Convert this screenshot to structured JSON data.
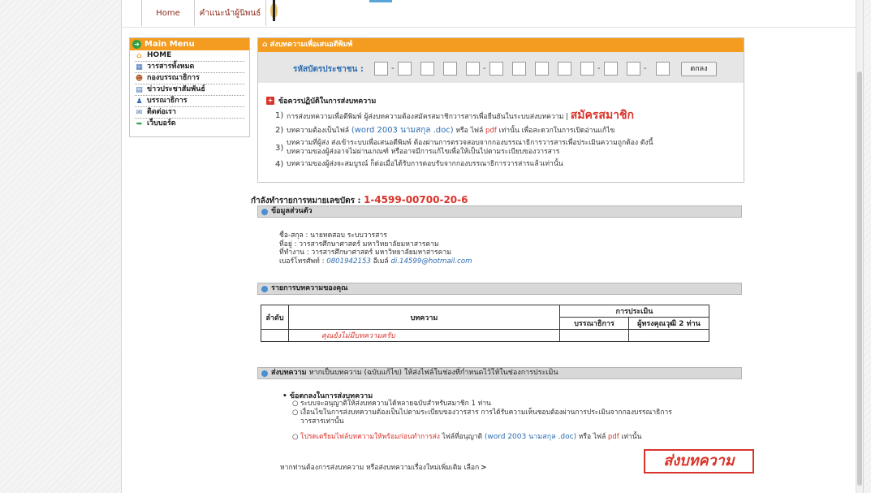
{
  "nav": {
    "home": "Home",
    "guide": "คำแนะนำผู้นิพนธ์"
  },
  "menu": {
    "title": "Main Menu",
    "items": [
      "HOME",
      "วารสารทั้งหมด",
      "กองบรรณาธิการ",
      "ข่าวประชาสัมพันธ์",
      "บรรณาธิการ",
      "ติดต่อเรา",
      "เว็บบอร์ด"
    ]
  },
  "submit_panel": {
    "title": "ส่งบทความเพื่อเสนอตีพิมพ์",
    "id_label": "รหัสบัตรประชาชน :",
    "ok_button": "ตกลง",
    "rules_title": "ข้อควรปฏิบัติในการส่งบทความ",
    "rules": [
      {
        "num": "1)",
        "text": "การส่งบทความเพื่อตีพิมพ์ ผู้ส่งบทความต้องสมัครสมาชิกวารสารเพื่อยืนยันในระบบส่งบทความ |",
        "link": "สมัครสมาชิก"
      },
      {
        "num": "2)",
        "pre": "บทความต้องเป็นไฟล์",
        "word": "(word 2003 นามสกุล .doc)",
        "mid": "หรือ ไฟล์",
        "pdf": "pdf",
        "post": "เท่านั้น เพื่อสะดวกในการเปิดอ่านแก้ไข"
      },
      {
        "num": "3)",
        "line1": "บทความที่ผู้ส่ง ส่งเข้าระบบเพื่อเสนอตีพิมพ์ ต้องผ่านการตรวจสอบจากกองบรรณาธิการวารสารเพื่อประเมินความถูกต้อง ดังนี้",
        "line2": "บทความของผู้ส่งอาจไม่ผ่านเกณฑ์ หรืออาจมีการแก้ไขเพื่อให้เป็นไปตามระเบียบของวารสาร"
      },
      {
        "num": "4)",
        "text": "บทความของผู้ส่งจะสมบูรณ์ ก็ต่อเมื่อได้รับการตอบรับจากกองบรรณาธิการวารสารแล้วเท่านั้น"
      }
    ]
  },
  "doing": {
    "label": "กำลังทำรายการหมายเลขบัตร :",
    "code": "1-4599-00700-20-6"
  },
  "personal": {
    "header": "ข้อมูลส่วนตัว",
    "name": "ชื่อ-สกุล : นายทดสอบ ระบบวารสาร",
    "address": "ที่อยู่ : วารสารศึกษาศาสตร์ มหาวิทยาลัยมหาสารคาม",
    "workplace": "ที่ทำงาน : วารสารศึกษาศาสตร์ มหาวิทยาลัยมหาสารคาม",
    "phone_label": "เบอร์โทรศัพท์ :",
    "phone": "0801942153",
    "email_label": "อีเมล์",
    "email": "di.14599@hotmail.com"
  },
  "articles": {
    "header": "รายการบทความของคุณ",
    "col_no": "ลำดับ",
    "col_article": "บทความ",
    "col_eval": "การประเมิน",
    "col_editor": "บรรณาธิการ",
    "col_reviewers": "ผู้ทรงคุณวุฒิ 2 ท่าน",
    "empty": "คุณยังไม่มีบทความครับ"
  },
  "submit_section": {
    "header_bold": "ส่งบทความ",
    "header_rest": "หากเป็นบทความ (ฉบับแก้ไข) ให้ส่งไฟล์ในช่องที่กำหนดไว้ให้ในช่องการประเมิน",
    "agreement_title": "ข้อตกลงในการส่งบทความ",
    "bullets": [
      "ระบบจะอนุญาติให้ส่งบทความได้หลายฉบับสำหรับสมาชิก 1 ท่าน",
      "เงื่อนไขในการส่งบทความต้องเป็นไปตามระเบียบของวารสาร การได้รับความเห็นชอบต้องผ่านการประเมินจากกองบรรณาธิการ",
      "วารสารเท่านั้น"
    ],
    "bullet3_red": "โปรดเตรียมไฟล์บทความให้พร้อมก่อนทำการส่ง",
    "bullet3_mid": "ไฟล์ที่อนุญาติ",
    "bullet3_word": "(word 2003 นามสกุล .doc)",
    "bullet3_or": "หรือ ไฟล์",
    "bullet3_pdf": "pdf",
    "bullet3_end": "เท่านั้น",
    "bottom_text": "หากท่านต้องการส่งบทความ หรือส่งบทความเรื่องใหม่เพิ่มเติม เลือก",
    "bottom_gt": ">",
    "submit_button": "ส่งบทความ"
  }
}
